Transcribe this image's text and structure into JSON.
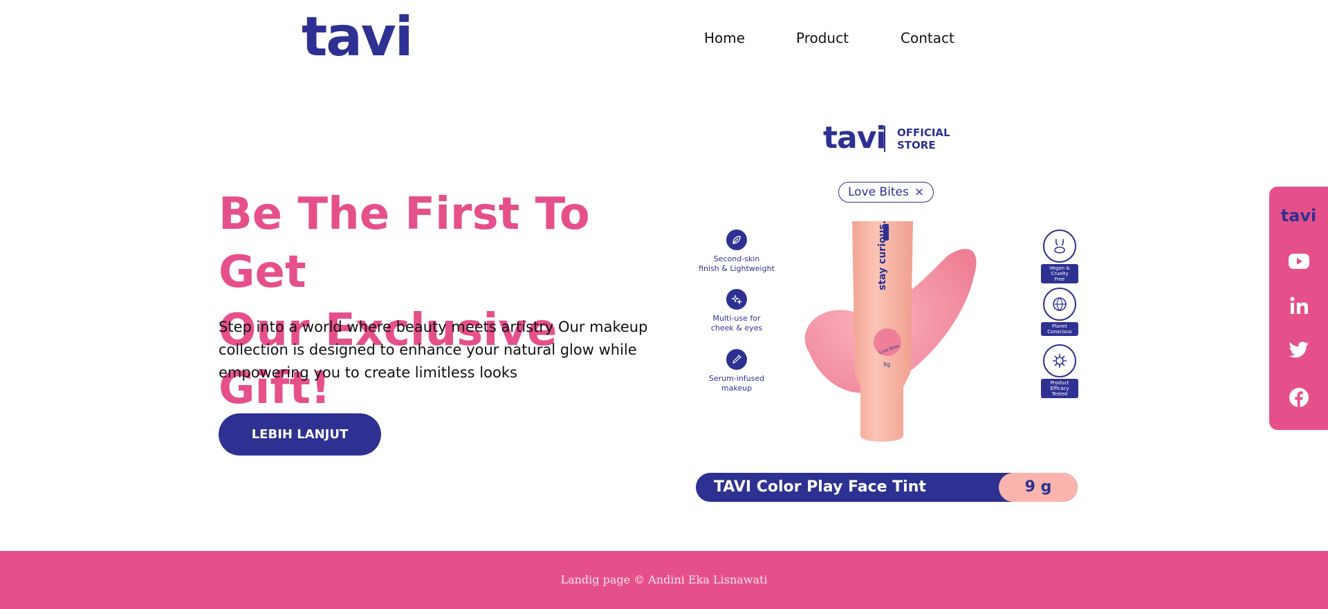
{
  "header": {
    "logo": "tavi",
    "nav": [
      {
        "label": "Home"
      },
      {
        "label": "Product"
      },
      {
        "label": "Contact"
      }
    ]
  },
  "hero": {
    "title_line1": "Be The First To Get",
    "title_line2": "Our Exclusive Gift!",
    "description_line1": "Step into a world where beauty meets artistry Our makeup",
    "description_line2": "collection is designed to enhance your natural glow while",
    "description_line3": "empowering you to create limitless looks",
    "cta_label": "LEBIH LANJUT"
  },
  "product_image": {
    "store_logo": "tavi",
    "store_label_line1": "OFFICIAL",
    "store_label_line2": "STORE",
    "variant": "Love Bites",
    "variant_close": "×",
    "features": [
      {
        "line1": "Second-skin",
        "line2": "finish & Lightweight",
        "icon": "leaf-icon"
      },
      {
        "line1": "Multi-use for",
        "line2": "cheek & eyes",
        "icon": "sparkle-icon"
      },
      {
        "line1": "Serum-infused",
        "line2": "makeup",
        "icon": "dropper-icon"
      }
    ],
    "badges": [
      {
        "line1": "Vegan &",
        "line2": "Cruelty",
        "line3": "Free",
        "icon": "bunny-icon"
      },
      {
        "line1": "Planet",
        "line2": "Conscious",
        "line3": "",
        "icon": "globe-icon"
      },
      {
        "line1": "Product",
        "line2": "Efficacy",
        "line3": "Tested",
        "icon": "gear-icon"
      }
    ],
    "tube_text": "stay curious.",
    "tube_label": "Love Bites",
    "tube_weight": "9g",
    "product_name": "TAVI Color Play Face Tint",
    "product_weight": "9 g",
    "colors": {
      "brand_navy": "#2e3192",
      "brand_pink": "#e6508a",
      "tube": "#f7b39f",
      "swatch": "#f38aa0"
    }
  },
  "social": {
    "logo": "tavi",
    "items": [
      {
        "name": "youtube",
        "icon": "youtube-icon"
      },
      {
        "name": "linkedin",
        "icon": "linkedin-icon"
      },
      {
        "name": "twitter",
        "icon": "twitter-icon"
      },
      {
        "name": "facebook",
        "icon": "facebook-icon"
      }
    ]
  },
  "footer": {
    "text": "Landig page © Andini Eka Lisnawati"
  }
}
